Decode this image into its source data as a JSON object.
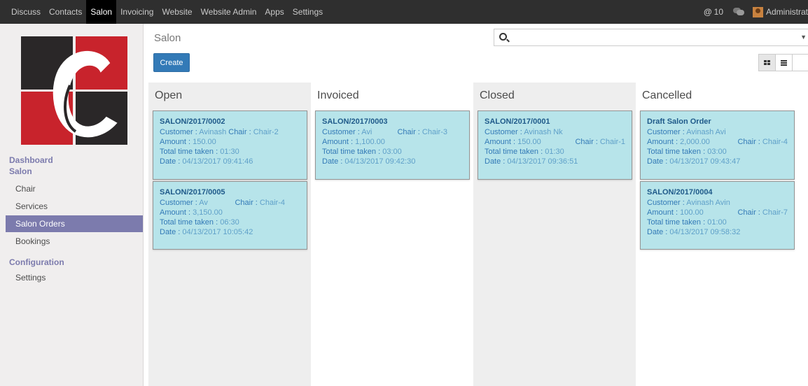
{
  "topbar": {
    "menu": [
      {
        "label": "Discuss",
        "active": false
      },
      {
        "label": "Contacts",
        "active": false
      },
      {
        "label": "Salon",
        "active": true
      },
      {
        "label": "Invoicing",
        "active": false
      },
      {
        "label": "Website",
        "active": false
      },
      {
        "label": "Website Admin",
        "active": false
      },
      {
        "label": "Apps",
        "active": false
      },
      {
        "label": "Settings",
        "active": false
      }
    ],
    "notification_count": "10",
    "user_name": "Administrator"
  },
  "sidebar": {
    "heading_dashboard": "Dashboard",
    "heading_salon": "Salon",
    "items": [
      {
        "label": "Chair"
      },
      {
        "label": "Services"
      },
      {
        "label": "Salon Orders"
      },
      {
        "label": "Bookings"
      }
    ],
    "heading_configuration": "Configuration",
    "config_items": [
      {
        "label": "Settings"
      }
    ]
  },
  "control": {
    "breadcrumb": "Salon",
    "create_label": "Create",
    "search_placeholder": ""
  },
  "labels": {
    "customer": "Customer : ",
    "chair": "Chair : ",
    "amount": "Amount : ",
    "time": "Total time taken : ",
    "date": "Date : "
  },
  "columns": [
    {
      "title": "Open",
      "cards": [
        {
          "ref": "SALON/2017/0002",
          "customer": "Avinash",
          "chair": "Chair-2",
          "amount": "150.00",
          "time": "01:30",
          "date": "04/13/2017 09:41:46",
          "layout": "customer-chair"
        },
        {
          "ref": "SALON/2017/0005",
          "customer": "Av",
          "chair": "Chair-4",
          "amount": "3,150.00",
          "time": "06:30",
          "date": "04/13/2017 10:05:42",
          "layout": "customer-chair"
        }
      ]
    },
    {
      "title": "Invoiced",
      "cards": [
        {
          "ref": "SALON/2017/0003",
          "customer": "Avi",
          "chair": "Chair-3",
          "amount": "1,100.00",
          "time": "03:00",
          "date": "04/13/2017 09:42:30",
          "layout": "customer-chair"
        }
      ]
    },
    {
      "title": "Closed",
      "cards": [
        {
          "ref": "SALON/2017/0001",
          "customer": "Avinash Nk",
          "chair": "Chair-1",
          "amount": "150.00",
          "time": "01:30",
          "date": "04/13/2017 09:36:51",
          "layout": "amount-chair"
        }
      ]
    },
    {
      "title": "Cancelled",
      "cards": [
        {
          "ref": "Draft Salon Order",
          "customer": "Avinash Avi",
          "chair": "Chair-4",
          "amount": "2,000.00",
          "time": "03:00",
          "date": "04/13/2017 09:43:47",
          "layout": "amount-chair"
        },
        {
          "ref": "SALON/2017/0004",
          "customer": "Avinash Avin",
          "chair": "Chair-7",
          "amount": "100.00",
          "time": "01:00",
          "date": "04/13/2017 09:58:32",
          "layout": "amount-chair"
        }
      ]
    }
  ]
}
